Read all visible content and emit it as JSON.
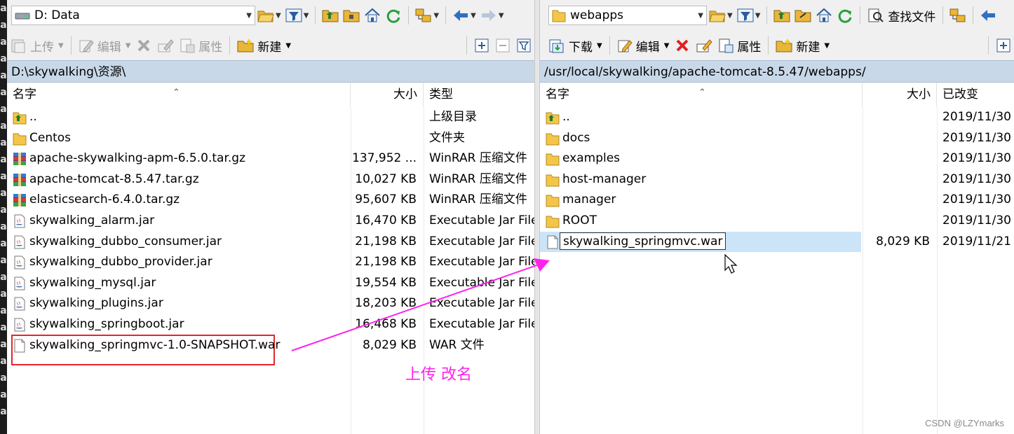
{
  "left": {
    "drive_combo": "D: Data",
    "toolbar2": {
      "upload": "上传",
      "edit": "编辑",
      "properties": "属性",
      "new": "新建"
    },
    "path": "D:\\skywalking\\资源\\",
    "columns": {
      "name": "名字",
      "size": "大小",
      "type": "类型"
    },
    "rows": [
      {
        "icon": "parent-folder-icon",
        "name": "..",
        "size": "",
        "type": "上级目录"
      },
      {
        "icon": "folder-icon",
        "name": "Centos",
        "size": "",
        "type": "文件夹"
      },
      {
        "icon": "winrar-archive-icon",
        "name": "apache-skywalking-apm-6.5.0.tar.gz",
        "size": "137,952 ...",
        "type": "WinRAR 压缩文件"
      },
      {
        "icon": "winrar-archive-icon",
        "name": "apache-tomcat-8.5.47.tar.gz",
        "size": "10,027 KB",
        "type": "WinRAR 压缩文件"
      },
      {
        "icon": "winrar-archive-icon",
        "name": "elasticsearch-6.4.0.tar.gz",
        "size": "95,607 KB",
        "type": "WinRAR 压缩文件"
      },
      {
        "icon": "jar-file-icon",
        "name": "skywalking_alarm.jar",
        "size": "16,470 KB",
        "type": "Executable Jar File"
      },
      {
        "icon": "jar-file-icon",
        "name": "skywalking_dubbo_consumer.jar",
        "size": "21,198 KB",
        "type": "Executable Jar File"
      },
      {
        "icon": "jar-file-icon",
        "name": "skywalking_dubbo_provider.jar",
        "size": "21,198 KB",
        "type": "Executable Jar File"
      },
      {
        "icon": "jar-file-icon",
        "name": "skywalking_mysql.jar",
        "size": "19,554 KB",
        "type": "Executable Jar File"
      },
      {
        "icon": "jar-file-icon",
        "name": "skywalking_plugins.jar",
        "size": "18,203 KB",
        "type": "Executable Jar File"
      },
      {
        "icon": "jar-file-icon",
        "name": "skywalking_springboot.jar",
        "size": "16,468 KB",
        "type": "Executable Jar File"
      },
      {
        "icon": "blank-file-icon",
        "name": "skywalking_springmvc-1.0-SNAPSHOT.war",
        "size": "8,029 KB",
        "type": "WAR 文件"
      }
    ]
  },
  "right": {
    "dir_combo": "webapps",
    "toolbar1": {
      "find": "查找文件"
    },
    "toolbar2": {
      "download": "下载",
      "edit": "编辑",
      "properties": "属性",
      "new": "新建"
    },
    "path": "/usr/local/skywalking/apache-tomcat-8.5.47/webapps/",
    "columns": {
      "name": "名字",
      "size": "大小",
      "changed": "已改变"
    },
    "rows": [
      {
        "icon": "parent-folder-icon",
        "name": "..",
        "size": "",
        "changed": "2019/11/30"
      },
      {
        "icon": "folder-icon",
        "name": "docs",
        "size": "",
        "changed": "2019/11/30"
      },
      {
        "icon": "folder-icon",
        "name": "examples",
        "size": "",
        "changed": "2019/11/30"
      },
      {
        "icon": "folder-icon",
        "name": "host-manager",
        "size": "",
        "changed": "2019/11/30"
      },
      {
        "icon": "folder-icon",
        "name": "manager",
        "size": "",
        "changed": "2019/11/30"
      },
      {
        "icon": "folder-icon",
        "name": "ROOT",
        "size": "",
        "changed": "2019/11/30"
      },
      {
        "icon": "blank-file-icon",
        "name": "skywalking_springmvc.war",
        "size": "8,029 KB",
        "changed": "2019/11/21"
      }
    ]
  },
  "annotation": {
    "text": "上传 改名",
    "color": "#ff22ee"
  },
  "watermark": "CSDN @LZYmarks",
  "edge_glyphs": "aaaaaaaaaaaaaaaaaaaaaaaaa",
  "colors": {
    "path_bar": "#c8d8e8",
    "selection": "#cce4f7",
    "highlight_box": "#e4262b"
  }
}
